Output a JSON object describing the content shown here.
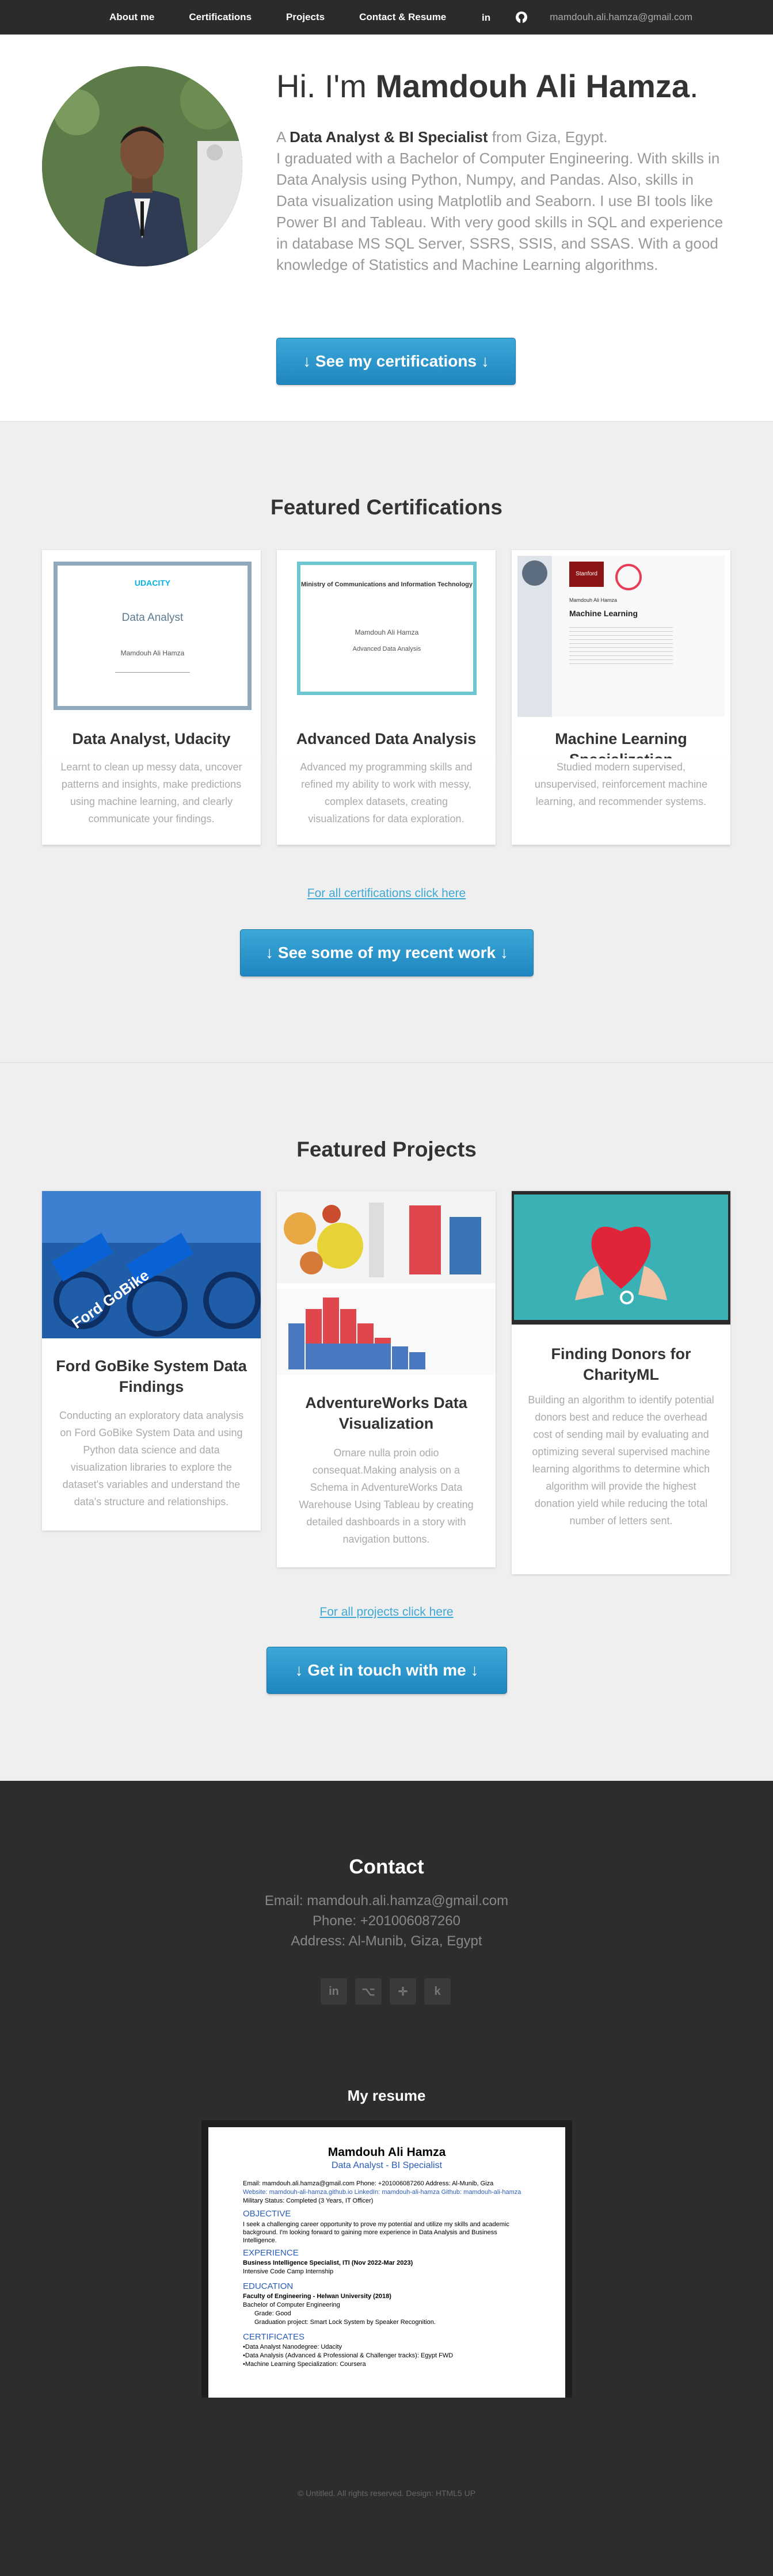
{
  "nav": {
    "items": [
      "About me",
      "Certifications",
      "Projects",
      "Contact & Resume"
    ],
    "linkedin_icon": "linkedin-icon",
    "github_icon": "github-icon",
    "email": "mamdouh.ali.hamza@gmail.com"
  },
  "hero": {
    "greeting": "Hi. I'm ",
    "name": "Mamdouh Ali Hamza",
    "period": ".",
    "intro_a": "A ",
    "role": "Data Analyst & BI Specialist",
    "location": " from Giza, Egypt.",
    "bio": "I graduated with a Bachelor of Computer Engineering. With skills in Data Analysis using Python, Numpy, and Pandas. Also, skills in Data visualization using Matplotlib and Seaborn. I use BI tools like Power BI and Tableau. With very good skills in SQL and experience in database MS SQL Server, SSRS, SSIS, and SSAS. With a good knowledge of Statistics and Machine Learning algorithms.",
    "button": "↓ See my certifications ↓"
  },
  "certifications": {
    "title": "Featured Certifications",
    "items": [
      {
        "title": "Data Analyst, Udacity",
        "text": "Learnt to clean up messy data, uncover patterns and insights, make predictions using machine learning, and clearly communicate your findings.",
        "img_brand": "UDACITY",
        "img_line": "Data Analyst",
        "img_name": "Mamdouh Ali Hamza"
      },
      {
        "title": "Advanced Data Analysis",
        "text": "Advanced my programming skills and refined my ability to work with messy, complex datasets, creating visualizations for data exploration.",
        "img_brand": "Ministry of Communications and Information Technology",
        "img_line": "Advanced Data Analysis",
        "img_name": "Mamdouh Ali Hamza"
      },
      {
        "title": "Machine Learning Specialization",
        "text": "Studied modern supervised, unsupervised, reinforcement machine learning, and recommender systems.",
        "img_brand": "Stanford",
        "img_line": "Machine Learning",
        "img_name": "Mamdouh Ali Hamza"
      }
    ],
    "all_link": "For all certifications click here",
    "button": "↓ See some of my recent work ↓"
  },
  "projects": {
    "title": "Featured Projects",
    "items": [
      {
        "title": "Ford GoBike System Data Findings",
        "text": "Conducting an exploratory data analysis on Ford GoBike System Data and using Python data science and data visualization libraries to explore the dataset's variables and understand the data's structure and relationships.",
        "img_label": "Ford GoBike"
      },
      {
        "title": "AdventureWorks Data Visualization",
        "text": "Ornare nulla proin odio consequat.Making analysis on a Schema in AdventureWorks Data Warehouse Using Tableau by creating detailed dashboards in a story with navigation buttons."
      },
      {
        "title": "Finding Donors for CharityML",
        "text": "Building an algorithm to identify potential donors best and reduce the overhead cost of sending mail by evaluating and optimizing several supervised machine learning algorithms to determine which algorithm will provide the highest donation yield while reducing the total number of letters sent."
      }
    ],
    "all_link": "For all projects click here",
    "button": "↓ Get in touch with me ↓"
  },
  "contact": {
    "title": "Contact",
    "email": "Email: mamdouh.ali.hamza@gmail.com",
    "phone": "Phone: +201006087260",
    "address": "Address: Al-Munib, Giza, Egypt",
    "social": [
      {
        "icon": "linkedin-icon",
        "glyph": "in"
      },
      {
        "icon": "github-icon",
        "glyph": "⌥"
      },
      {
        "icon": "tableau-icon",
        "glyph": "✛"
      },
      {
        "icon": "kaggle-icon",
        "glyph": "k"
      }
    ],
    "resume_title": "My resume"
  },
  "resume": {
    "name": "Mamdouh Ali Hamza",
    "role": "Data Analyst - BI Specialist",
    "line1": "Email: mamdouh.ali.hamza@gmail.com     Phone: +201006087260     Address: Al-Munib, Giza",
    "line2": "Website: mamdouh-ali-hamza.github.io   LinkedIn: mamdouh-ali-hamza   Github: mamdouh-ali-hamza",
    "line3": "Military Status: Completed (3 Years, IT Officer)",
    "objective": "OBJECTIVE",
    "objective_text": "I seek a challenging career opportunity to prove my potential and utilize my skills and academic background. I'm looking forward to gaining more experience in Data Analysis and Business Intelligence.",
    "experience": "EXPERIENCE",
    "exp_line": "Business Intelligence Specialist, ITI                                                    (Nov 2022-Mar 2023)",
    "exp_line2": "Intensive Code Camp Internship",
    "education": "EDUCATION",
    "edu_line": "Faculty of Engineering - Helwan University                                                    (2018)",
    "edu_line2": "Bachelor of Computer Engineering",
    "edu_line3": "Grade: Good",
    "edu_line4": "Graduation project: Smart Lock System by Speaker Recognition.",
    "certs": "CERTIFICATES",
    "cert1": "•Data Analyst Nanodegree: Udacity",
    "cert2": "•Data Analysis (Advanced & Professional & Challenger tracks): Egypt FWD",
    "cert3": "•Machine Learning Specialization: Coursera"
  },
  "footer": {
    "copyright": "© Untitled. All rights reserved.     Design: HTML5 UP"
  },
  "colors": {
    "accent": "#3fa9d6",
    "dark": "#2b2b2b"
  }
}
